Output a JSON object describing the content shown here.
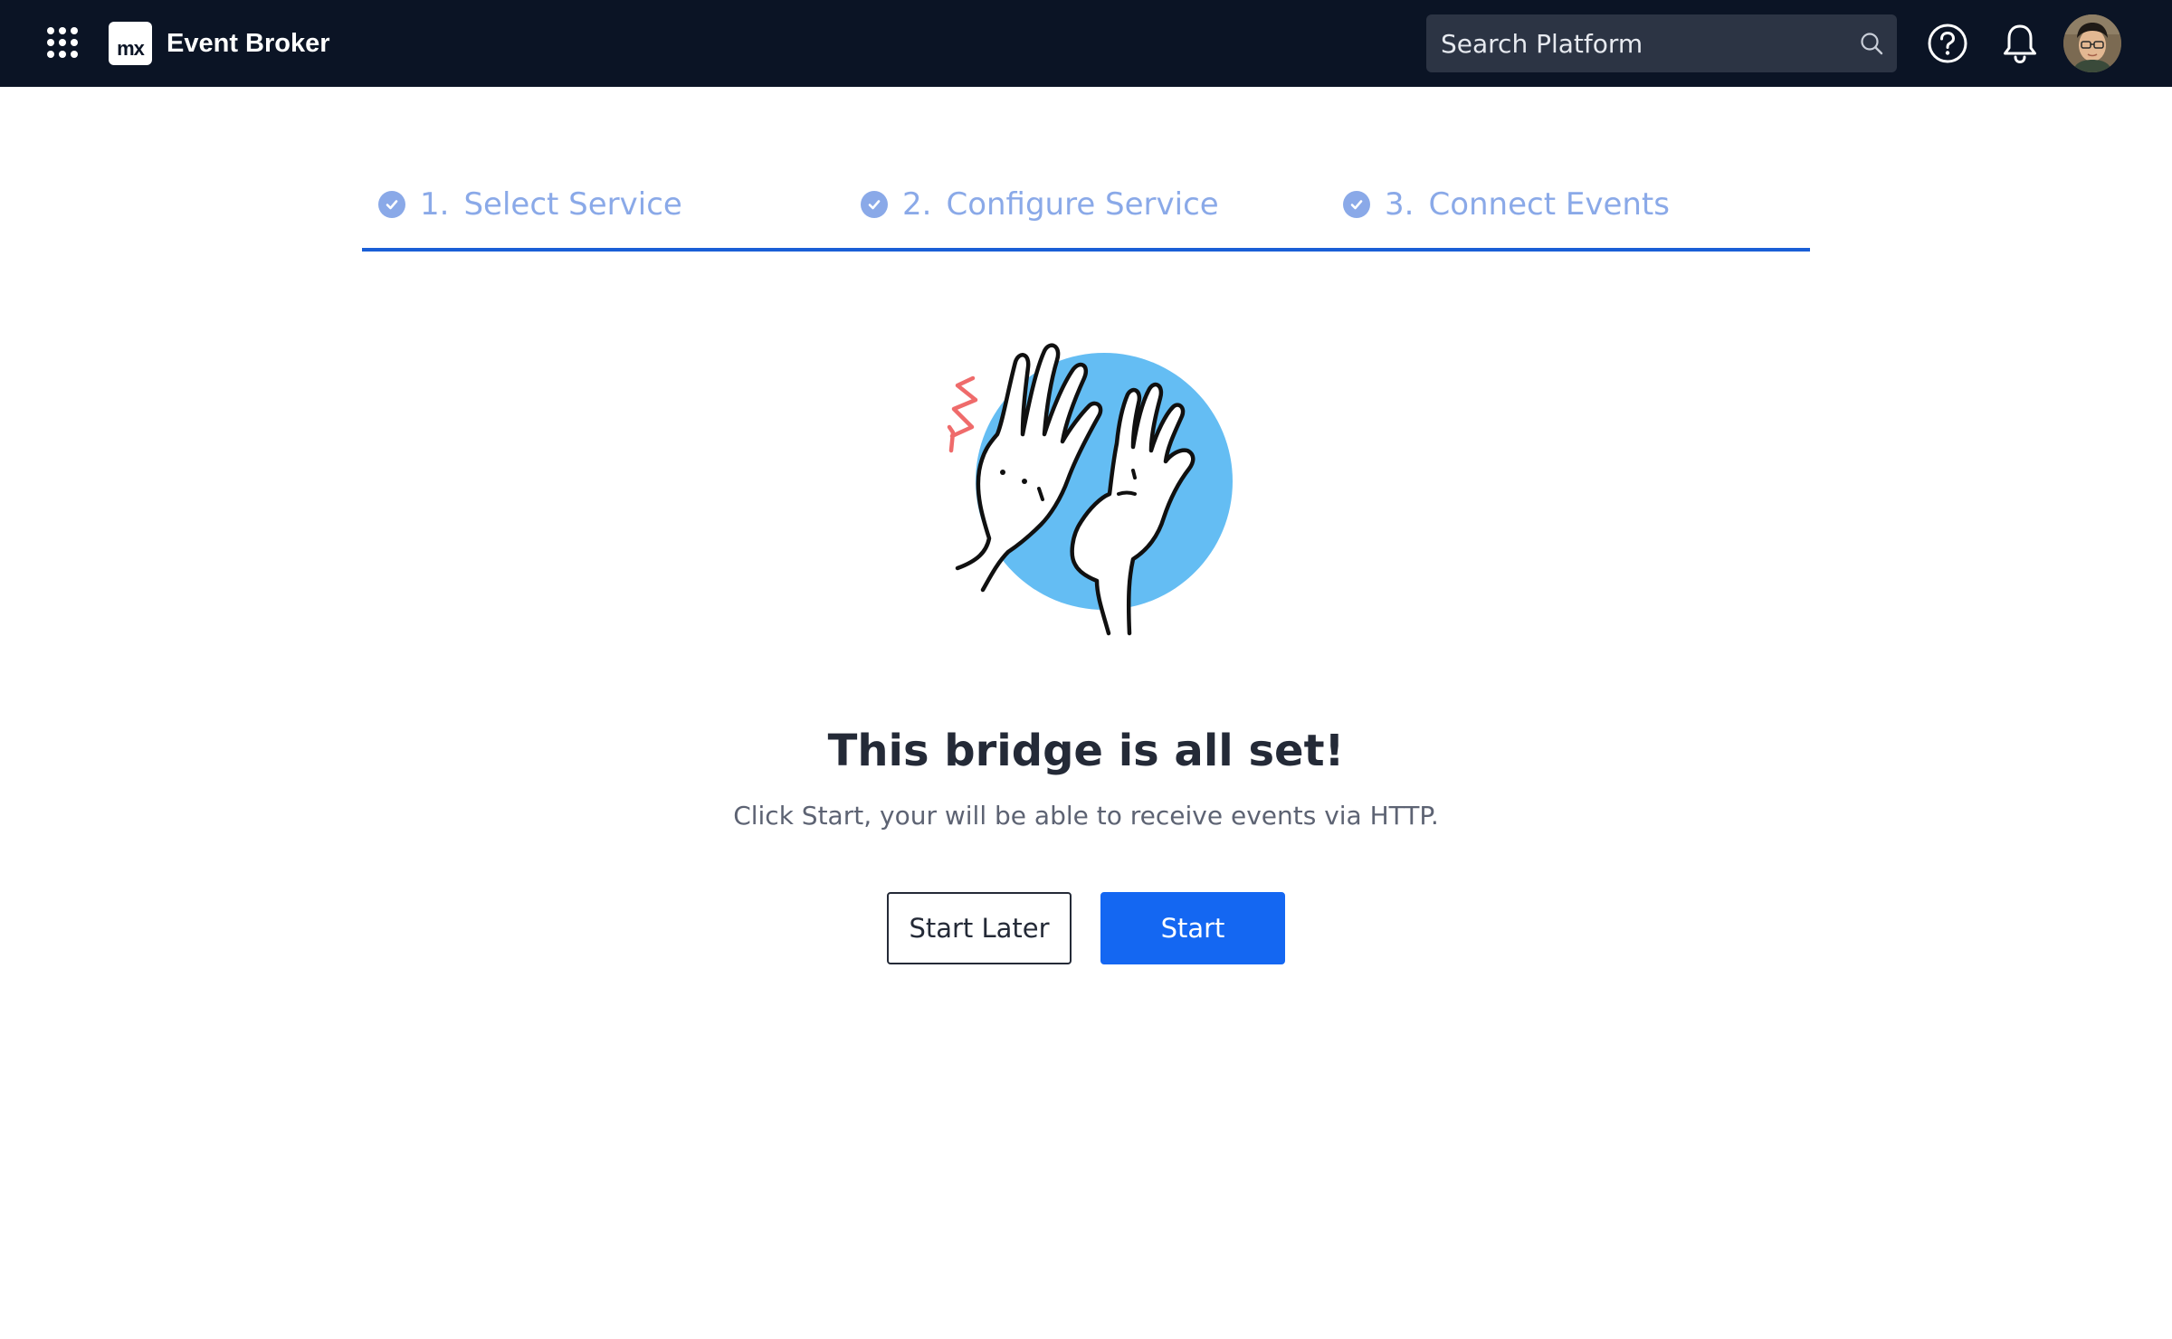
{
  "header": {
    "logo_text": "mx",
    "app_title": "Event Broker",
    "search": {
      "placeholder": "Search Platform",
      "value": ""
    },
    "icons": [
      "apps-grid-icon",
      "search-icon",
      "help-icon",
      "bell-icon"
    ],
    "background_color": "#0b1425"
  },
  "stepper": {
    "steps": [
      {
        "number": "1.",
        "label": "Select Service",
        "status": "complete"
      },
      {
        "number": "2.",
        "label": "Configure Service",
        "status": "complete"
      },
      {
        "number": "3.",
        "label": "Connect Events",
        "status": "complete"
      }
    ],
    "accent_color": "#1a5fd6",
    "step_color": "#8aa9e8"
  },
  "main": {
    "illustration": "high-five-illustration",
    "title": "This bridge is all set!",
    "subtitle": "Click Start, your will be able to receive events via HTTP.",
    "buttons": {
      "secondary_label": "Start Later",
      "primary_label": "Start"
    },
    "primary_color": "#1467f2"
  }
}
